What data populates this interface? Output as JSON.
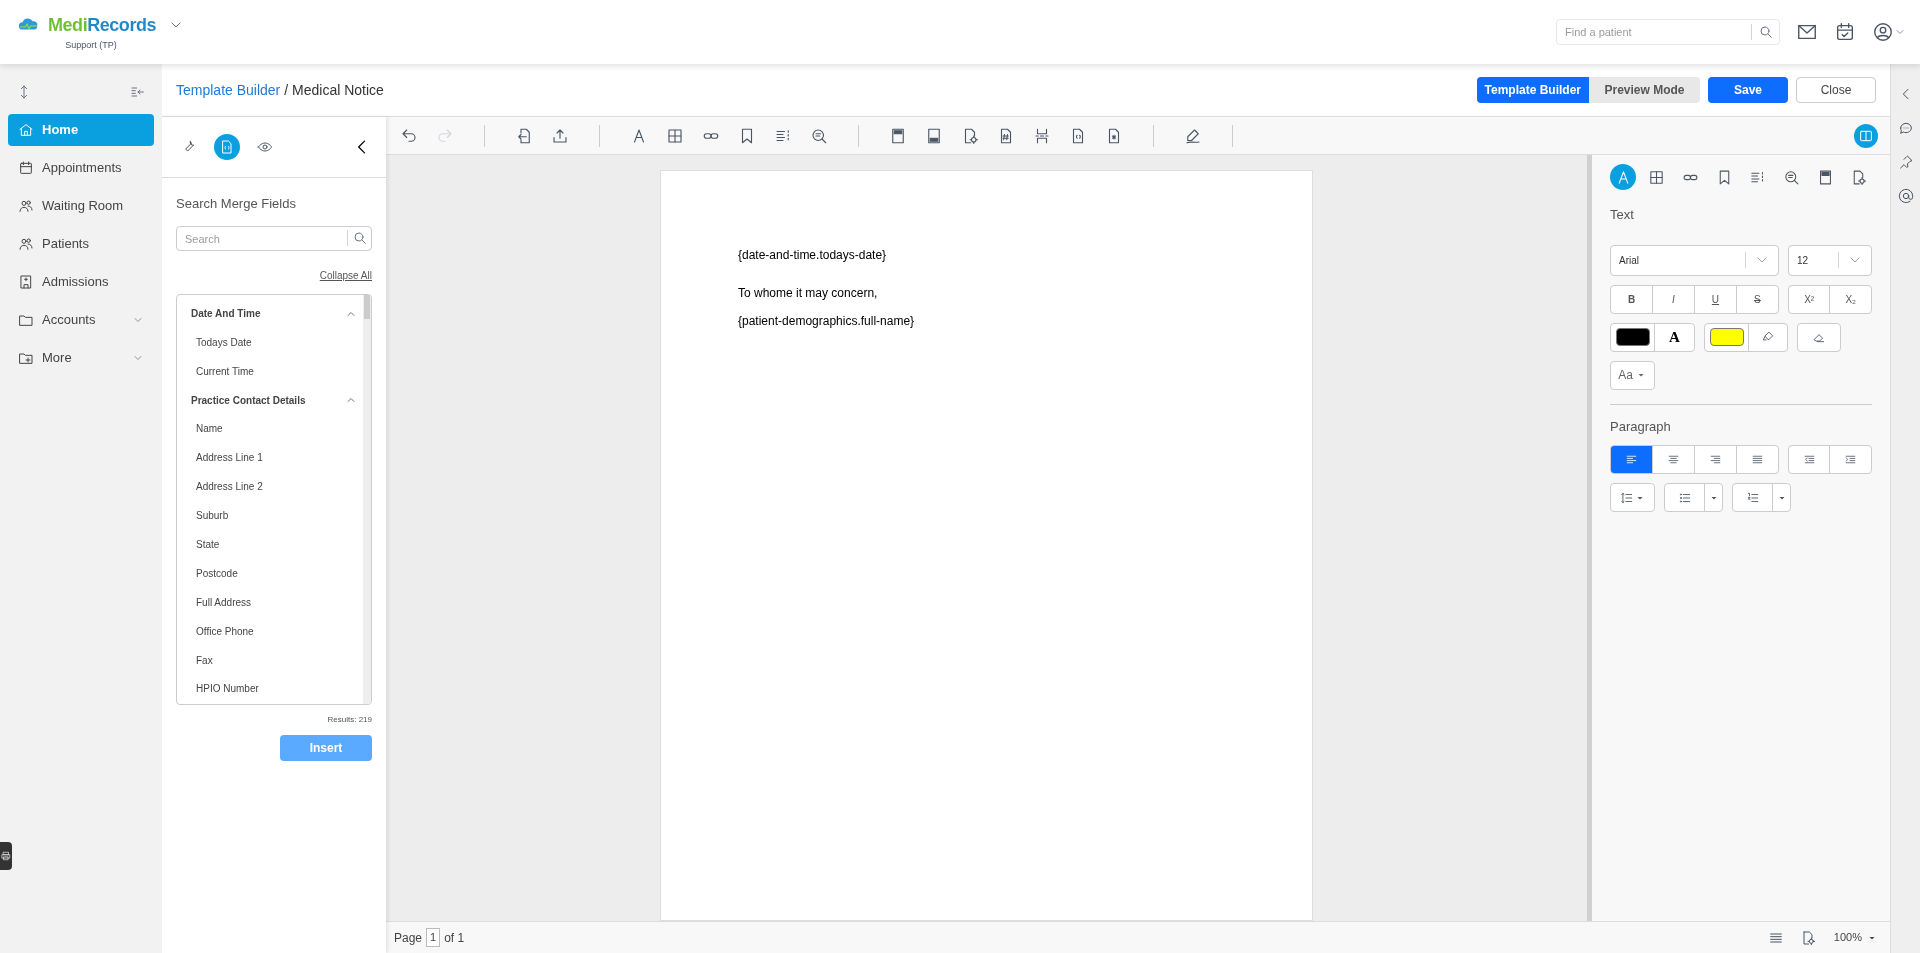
{
  "header": {
    "brand": "MediRecords",
    "subtitle": "Support (TP)",
    "search": {
      "placeholder": "Find a patient"
    }
  },
  "sidebar": {
    "items": [
      {
        "label": "Home",
        "selected": true,
        "expandable": false
      },
      {
        "label": "Appointments",
        "selected": false,
        "expandable": false
      },
      {
        "label": "Waiting Room",
        "selected": false,
        "expandable": false
      },
      {
        "label": "Patients",
        "selected": false,
        "expandable": false
      },
      {
        "label": "Admissions",
        "selected": false,
        "expandable": false
      },
      {
        "label": "Accounts",
        "selected": false,
        "expandable": true
      },
      {
        "label": "More",
        "selected": false,
        "expandable": true
      }
    ]
  },
  "title_bar": {
    "breadcrumb_link": "Template Builder",
    "page_title": "/ Medical Notice",
    "modes": [
      {
        "label": "Template Builder",
        "selected": true
      },
      {
        "label": "Preview Mode",
        "selected": false
      }
    ],
    "save": "Save",
    "close": "Close"
  },
  "merge_panel": {
    "tabs": [
      {
        "selected": false
      },
      {
        "selected": true
      },
      {
        "selected": false
      }
    ],
    "heading": "Search Merge Fields",
    "search": {
      "placeholder": "Search"
    },
    "collapse_all": "Collapse All",
    "groups": [
      {
        "label": "Date And Time",
        "expanded": true,
        "children": [
          {
            "label": "Todays Date"
          },
          {
            "label": "Current Time"
          }
        ]
      },
      {
        "label": "Practice Contact Details",
        "expanded": true,
        "children": [
          {
            "label": "Name"
          },
          {
            "label": "Address Line 1"
          },
          {
            "label": "Address Line 2"
          },
          {
            "label": "Suburb"
          },
          {
            "label": "State"
          },
          {
            "label": "Postcode"
          },
          {
            "label": "Full Address"
          },
          {
            "label": "Office Phone"
          },
          {
            "label": "Fax"
          },
          {
            "label": "HPIO Number"
          }
        ]
      }
    ],
    "results": "Results: 219",
    "insert": "Insert"
  },
  "toolbar": {
    "undo": {
      "disabled": false
    },
    "redo": {
      "disabled": true
    }
  },
  "document": {
    "paragraphs": [
      "{date-and-time.todays-date}",
      "To whome it may concern,",
      "{patient-demographics.full-name}"
    ]
  },
  "format_panel": {
    "tabs": [
      {
        "selected": true
      },
      {
        "selected": false
      },
      {
        "selected": false
      },
      {
        "selected": false
      },
      {
        "selected": false
      },
      {
        "selected": false
      },
      {
        "selected": false
      },
      {
        "selected": false
      }
    ],
    "text_heading": "Text",
    "font": "Arial",
    "size": "12",
    "style_buttons": [
      "B",
      "I",
      "U",
      "S",
      "X²",
      "X₂"
    ],
    "color_swatches": [
      {
        "color": "#000000"
      },
      {
        "color": "#ffff00"
      }
    ],
    "text_color_glyph": "A",
    "case_button": "Aa",
    "paragraph_heading": "Paragraph",
    "alignments": [
      {
        "selected": true
      },
      {
        "selected": false
      },
      {
        "selected": false
      },
      {
        "selected": false
      }
    ]
  },
  "status_bar": {
    "page_label": "Page",
    "page": "1",
    "page_total": "of 1",
    "zoom": "100%"
  }
}
